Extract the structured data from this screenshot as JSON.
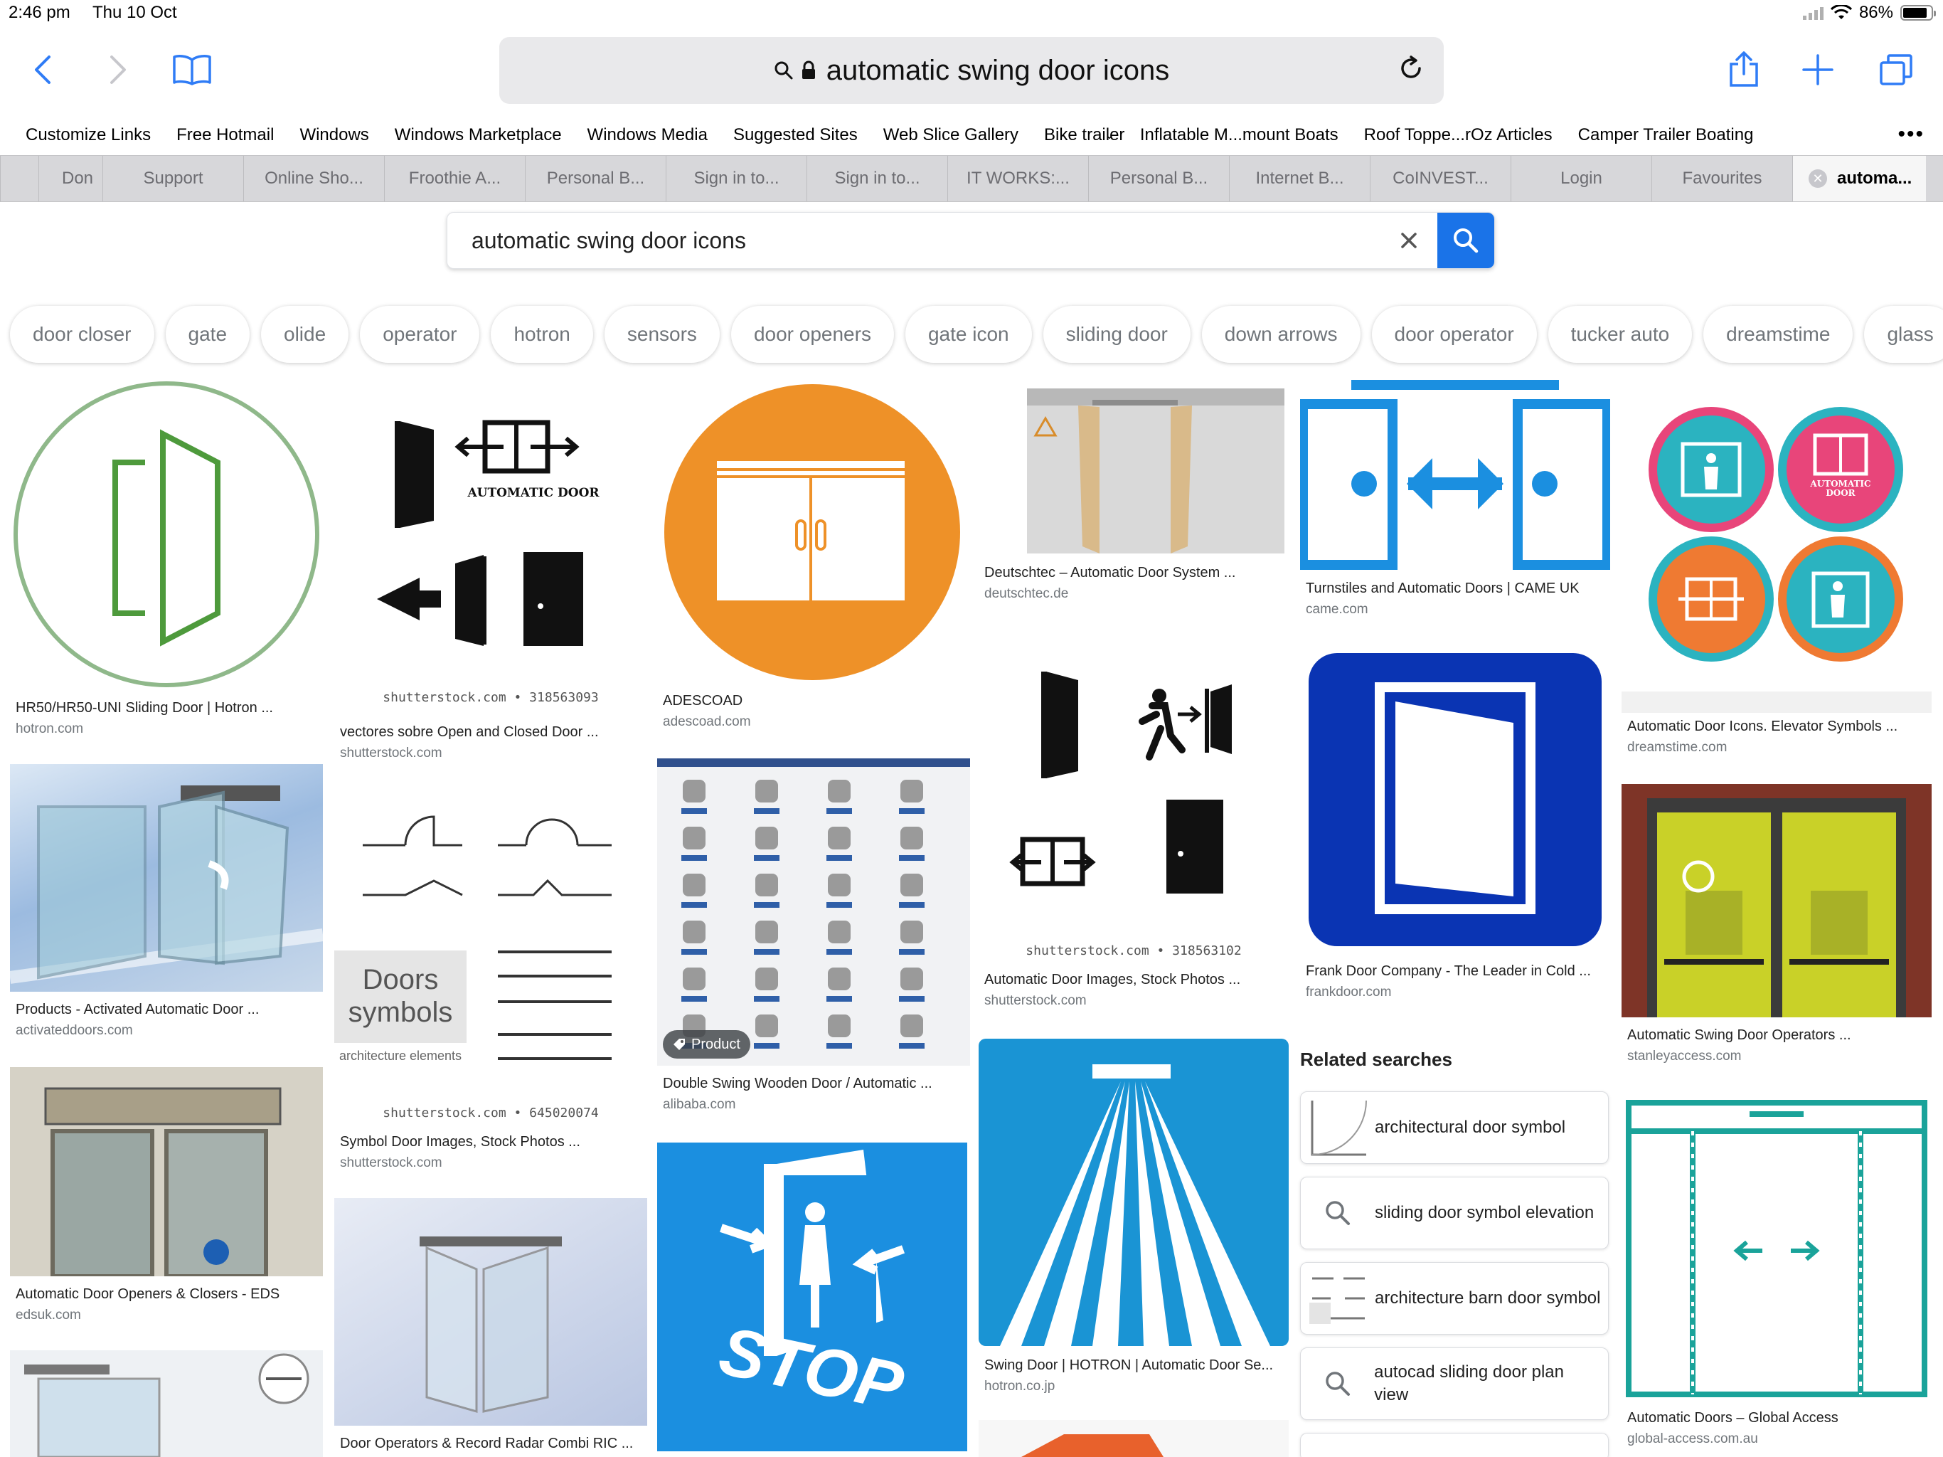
{
  "status": {
    "time": "2:46 pm",
    "date": "Thu 10 Oct",
    "battery": "86%",
    "battery_level": 0.86
  },
  "address_bar": {
    "text": "automatic swing  door icons"
  },
  "favourites": [
    "Customize Links",
    "Free Hotmail",
    "Windows",
    "Windows Marketplace",
    "Windows Media",
    "Suggested Sites",
    "Web Slice Gallery",
    "Bike trailer",
    "Inflatable M...mount Boats",
    "Roof Toppe...rOz Articles",
    "Camper Trailer Boating"
  ],
  "favourites_more": "•••",
  "tabs": [
    "Don",
    "Support",
    "Online Sho...",
    "Froothie A...",
    "Personal B...",
    "Sign in to...",
    "Sign in to...",
    "IT WORKS:...",
    "Personal B...",
    "Internet B...",
    "CoINVEST...",
    "Login",
    "Favourites"
  ],
  "active_tab": "automa...",
  "search": {
    "query": "automatic swing  door icons"
  },
  "chips": [
    "door closer",
    "gate",
    "olide",
    "operator",
    "hotron",
    "sensors",
    "door openers",
    "gate icon",
    "sliding door",
    "down arrows",
    "door operator",
    "tucker auto",
    "dreamstime",
    "glass"
  ],
  "results": {
    "r1": {
      "title": "HR50/HR50-UNI Sliding Door | Hotron ...",
      "domain": "hotron.com"
    },
    "r2": {
      "title": "Products - Activated Automatic Door ...",
      "domain": "activateddoors.com"
    },
    "r3": {
      "title": "Automatic Door Openers & Closers - EDS",
      "domain": "edsuk.com"
    },
    "r4": {
      "title": "vectores sobre Open and Closed Door ...",
      "domain": "shutterstock.com",
      "watermark": "shutterstock.com • 318563093",
      "label": "AUTOMATIC DOOR"
    },
    "r5": {
      "title": "Symbol Door Images, Stock Photos ...",
      "domain": "shutterstock.com",
      "watermark": "shutterstock.com • 645020074",
      "big": "Doors symbols",
      "sub": "architecture elements"
    },
    "r6": {
      "title": "Door Operators & Record Radar Combi RIC ...",
      "domain": ""
    },
    "r7": {
      "title": "ADESCOAD",
      "domain": "adescoad.com"
    },
    "r8": {
      "title": "Double Swing Wooden Door / Automatic ...",
      "domain": "alibaba.com",
      "badge": "Product"
    },
    "r9": {
      "title": "Deutschtec – Automatic Door System ...",
      "domain": "deutschtec.de"
    },
    "r10": {
      "title": "Automatic Door Images, Stock Photos ...",
      "domain": "shutterstock.com",
      "watermark": "shutterstock.com • 318563102"
    },
    "r11": {
      "title": "Swing Door | HOTRON | Automatic Door Se...",
      "domain": "hotron.co.jp"
    },
    "r12": {
      "title": "Turnstiles and Automatic Doors | CAME UK",
      "domain": "came.com"
    },
    "r13": {
      "title": "Frank Door Company - The Leader in Cold ...",
      "domain": "frankdoor.com"
    },
    "r14": {
      "title": "Automatic Door Icons. Elevator Symbols ...",
      "domain": "dreamstime.com",
      "label": "AUTOMATIC DOOR"
    },
    "r15": {
      "title": "Automatic Swing Door Operators ...",
      "domain": "stanleyaccess.com"
    },
    "r16": {
      "title": "Automatic Doors – Global Access",
      "domain": "global-access.com.au"
    }
  },
  "related": {
    "heading": "Related searches",
    "items": [
      "architectural door symbol",
      "sliding door symbol elevation",
      "architecture barn door symbol",
      "autocad sliding door plan view"
    ]
  },
  "colors": {
    "accent": "#1a73e8",
    "ios_blue": "#2f7cf6",
    "orange": "#ee9128",
    "came_blue": "#1b8fe0",
    "frank_blue": "#0a34b3",
    "hotron_blue": "#1a94d4"
  }
}
